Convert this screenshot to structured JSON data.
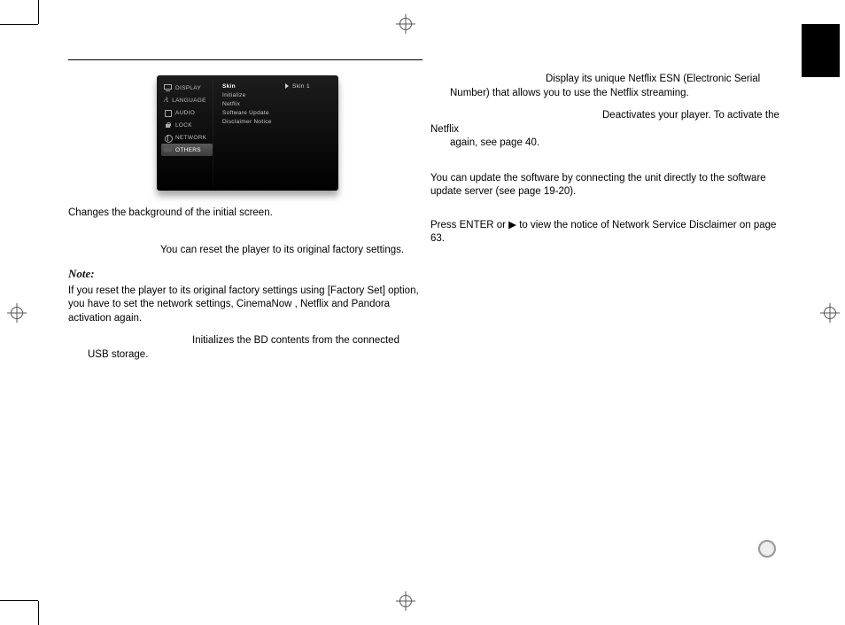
{
  "menu": {
    "sidebar": [
      {
        "icon": "display-icon",
        "label": "DISPLAY"
      },
      {
        "icon": "language-icon",
        "label": "LANGUAGE"
      },
      {
        "icon": "audio-icon",
        "label": "AUDIO"
      },
      {
        "icon": "lock-icon",
        "label": "LOCK"
      },
      {
        "icon": "network-icon",
        "label": "NETWORK"
      },
      {
        "icon": "others-icon",
        "label": "OTHERS"
      }
    ],
    "options": [
      "Skin",
      "Initialize",
      "Netflix",
      "Software Update",
      "Disclaimer Notice"
    ],
    "value_arrow": "▸",
    "value": "Skin 1"
  },
  "left": {
    "skin_text": "Changes the background of the initial screen.",
    "factory_text": "You can reset the player to its original factory settings.",
    "note_label": "Note:",
    "note_text": "If you reset the player to its original factory settings using [Factory Set] option, you have to set the network settings, CinemaNow , Netflix and Pandora activation again.",
    "bd_text_lead": "Initializes the BD contents from the connected",
    "bd_text_tail": "USB storage."
  },
  "right": {
    "esn_lead": "Display its unique Netflix ESN (Electronic Serial",
    "esn_tail": "Number) that allows you to use the Netflix streaming.",
    "deact_lead": "Deactivates your player. To activate the Netflix",
    "deact_tail": "again, see page 40.",
    "update_text": "You can update the software by connecting the unit directly to the software update server (see page 19-20).",
    "disclaimer_text": "Press ENTER or ▶ to view the notice of Network Service Disclaimer on page 63."
  },
  "glyphs": {
    "play": "▶"
  }
}
